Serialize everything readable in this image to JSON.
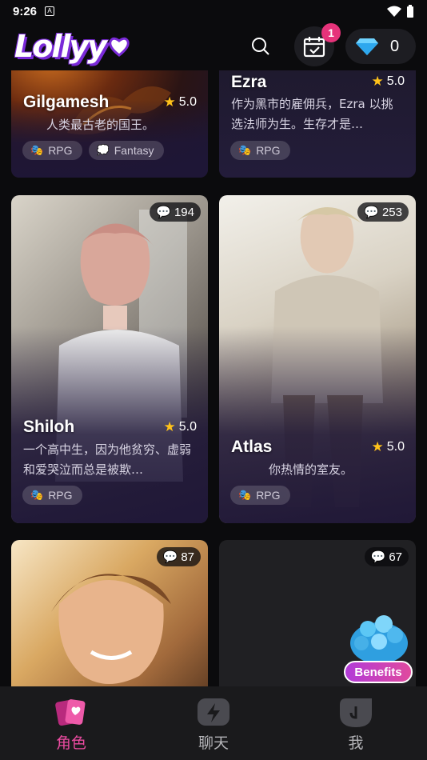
{
  "status_bar": {
    "time": "9:26"
  },
  "header": {
    "logo": "Lollyy",
    "checkin_badge": "1",
    "gems": "0"
  },
  "cards": [
    {
      "name": "Gilgamesh",
      "rating": "5.0",
      "desc": "人类最古老的国王。",
      "tags": [
        "RPG",
        "Fantasy"
      ]
    },
    {
      "name": "Ezra",
      "rating": "5.0",
      "desc": "作为黑市的雇佣兵，Ezra 以挑选法师为生。生存才是…",
      "tags": [
        "RPG"
      ]
    },
    {
      "name": "Shiloh",
      "rating": "5.0",
      "count": "194",
      "desc": "一个高中生，因为他贫穷、虚弱和爱哭泣而总是被欺…",
      "tags": [
        "RPG"
      ]
    },
    {
      "name": "Atlas",
      "rating": "5.0",
      "count": "253",
      "desc": "你热情的室友。",
      "tags": [
        "RPG"
      ]
    },
    {
      "count": "87"
    },
    {
      "count": "67"
    }
  ],
  "benefits": {
    "label": "Benefits"
  },
  "nav": [
    {
      "label": "角色"
    },
    {
      "label": "聊天"
    },
    {
      "label": "我"
    }
  ],
  "colors": {
    "accent": "#ea4ba0",
    "badge": "#e6337a",
    "star": "#ffc21a",
    "background": "#0b0b0d"
  }
}
